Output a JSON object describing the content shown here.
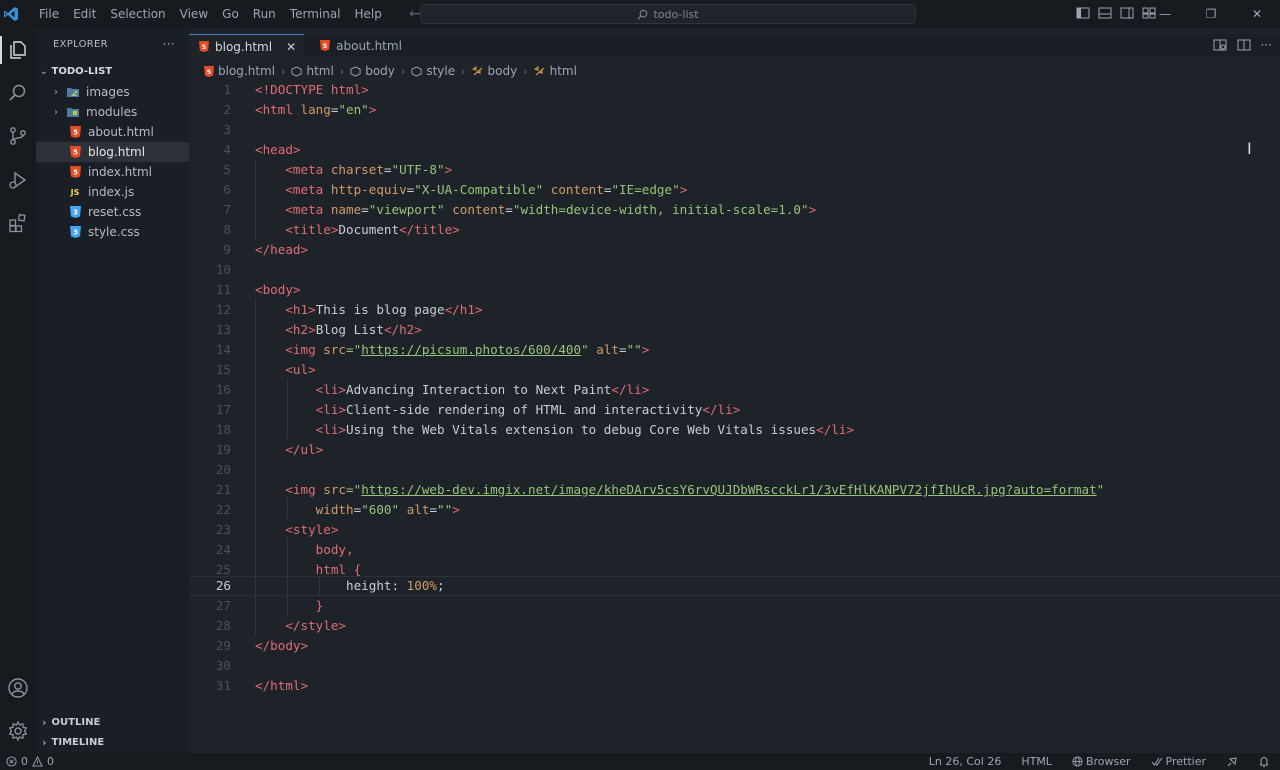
{
  "titlebar": {
    "menu": [
      "File",
      "Edit",
      "Selection",
      "View",
      "Go",
      "Run",
      "Terminal",
      "Help"
    ],
    "search_text": "todo-list"
  },
  "sidebar": {
    "title": "EXPLORER",
    "more_label": "···",
    "folder": "TODO-LIST",
    "items": [
      {
        "label": "images",
        "type": "folder",
        "icon": "image-folder-icon"
      },
      {
        "label": "modules",
        "type": "folder",
        "icon": "modules-folder-icon"
      },
      {
        "label": "about.html",
        "type": "html",
        "icon": "html5-icon"
      },
      {
        "label": "blog.html",
        "type": "html",
        "icon": "html5-icon"
      },
      {
        "label": "index.html",
        "type": "html",
        "icon": "html5-icon"
      },
      {
        "label": "index.js",
        "type": "js",
        "icon": "js-icon"
      },
      {
        "label": "reset.css",
        "type": "css",
        "icon": "css3-icon"
      },
      {
        "label": "style.css",
        "type": "css",
        "icon": "css3-icon"
      }
    ],
    "outline": "OUTLINE",
    "timeline": "TIMELINE"
  },
  "tabs": [
    {
      "label": "blog.html",
      "active": true
    },
    {
      "label": "about.html",
      "active": false
    }
  ],
  "breadcrumb": [
    "blog.html",
    "html",
    "body",
    "style",
    "body",
    "html"
  ],
  "editor": {
    "current_line": 26,
    "lines": [
      "1",
      "2",
      "3",
      "4",
      "5",
      "6",
      "7",
      "8",
      "9",
      "10",
      "11",
      "12",
      "13",
      "14",
      "15",
      "16",
      "17",
      "18",
      "19",
      "20",
      "21",
      "22",
      "23",
      "24",
      "25",
      "26",
      "27",
      "28",
      "29",
      "30",
      "31"
    ],
    "code": {
      "l1": "<!DOCTYPE html>",
      "l2a": "<html ",
      "l2b": "lang",
      "l2c": "=",
      "l2d": "\"en\"",
      "l2e": ">",
      "l4": "<head>",
      "l5a": "<meta ",
      "l5b": "charset",
      "l5c": "=",
      "l5d": "\"UTF-8\"",
      "l5e": ">",
      "l6a": "<meta ",
      "l6b": "http-equiv",
      "l6c": "=",
      "l6d": "\"X-UA-Compatible\"",
      "l6e": " content",
      "l6f": "=",
      "l6g": "\"IE=edge\"",
      "l6h": ">",
      "l7a": "<meta ",
      "l7b": "name",
      "l7c": "=",
      "l7d": "\"viewport\"",
      "l7e": " content",
      "l7f": "=",
      "l7g": "\"width=device-width, initial-scale=1.0\"",
      "l7h": ">",
      "l8a": "<title>",
      "l8b": "Document",
      "l8c": "</title>",
      "l9": "</head>",
      "l11": "<body>",
      "l12a": "<h1>",
      "l12b": "This is blog page",
      "l12c": "</h1>",
      "l13a": "<h2>",
      "l13b": "Blog List",
      "l13c": "</h2>",
      "l14a": "<img ",
      "l14b": "src",
      "l14c": "=\"",
      "l14d": "https://picsum.photos/600/400",
      "l14e": "\"",
      "l14f": " alt",
      "l14g": "=",
      "l14h": "\"\"",
      "l14i": ">",
      "l15": "<ul>",
      "l16a": "<li>",
      "l16b": "Advancing Interaction to Next Paint",
      "l16c": "</li>",
      "l17a": "<li>",
      "l17b": "Client-side rendering of HTML and interactivity",
      "l17c": "</li>",
      "l18a": "<li>",
      "l18b": "Using the Web Vitals extension to debug Core Web Vitals issues",
      "l18c": "</li>",
      "l19": "</ul>",
      "l21a": "<img ",
      "l21b": "src",
      "l21c": "=\"",
      "l21d": "https://web-dev.imgix.net/image/kheDArv5csY6rvQUJDbWRscckLr1/3vEfHlKANPV72jfIhUcR.jpg?auto=format",
      "l21e": "\"",
      "l22a": "width",
      "l22b": "=",
      "l22c": "\"600\"",
      "l22d": " alt",
      "l22e": "=",
      "l22f": "\"\"",
      "l22g": ">",
      "l23": "<style>",
      "l24": "body,",
      "l25": "html {",
      "l26a": "height",
      "l26b": ": ",
      "l26c": "100%",
      "l26d": ";",
      "l27": "}",
      "l28": "</style>",
      "l29": "</body>",
      "l31": "</html>"
    }
  },
  "statusbar": {
    "errors": "0",
    "warnings": "0",
    "position": "Ln 26, Col 26",
    "language": "HTML",
    "browser": "Browser",
    "prettier": "Prettier"
  },
  "colors": {
    "tag": "#e06c75",
    "attr": "#d19a66",
    "string": "#98c379",
    "accent": "#4d78cc",
    "background": "#1e2329",
    "html5": "#e44d26",
    "css3": "#42a5f5",
    "js": "#f1d34d"
  }
}
